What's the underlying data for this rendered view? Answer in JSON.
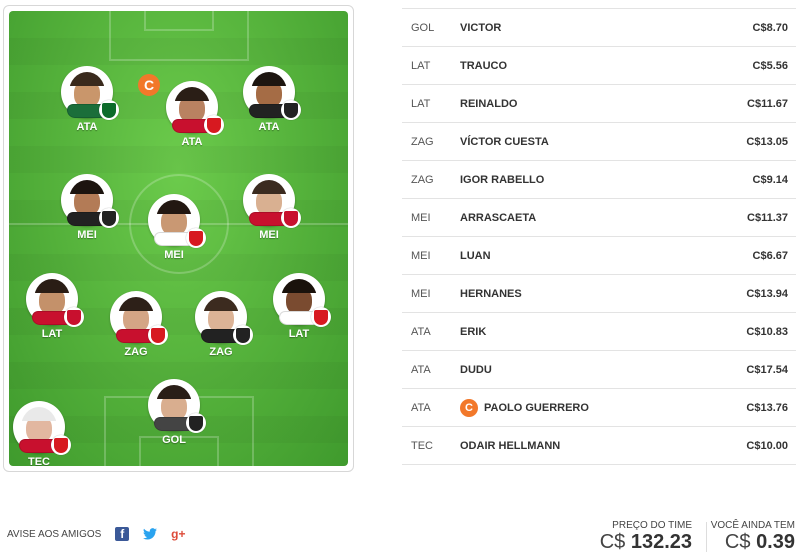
{
  "field": {
    "players": [
      {
        "pos": "ATA",
        "shirt": "#1b6e3a",
        "skin": "#c9966b",
        "hair": "#3a2a1d",
        "club_color": "#0c6b2a"
      },
      {
        "pos": "ATA",
        "shirt": "#c8102e",
        "skin": "#b98261",
        "hair": "#2a1e16",
        "club_color": "#d71920",
        "captain": true
      },
      {
        "pos": "ATA",
        "shirt": "#222222",
        "skin": "#a56c45",
        "hair": "#1d1510",
        "club_color": "#222222"
      },
      {
        "pos": "MEI",
        "shirt": "#222222",
        "skin": "#b37b56",
        "hair": "#1c140f",
        "club_color": "#222222"
      },
      {
        "pos": "MEI",
        "shirt": "#ffffff",
        "skin": "#c99873",
        "hair": "#221711",
        "club_color": "#d71920"
      },
      {
        "pos": "MEI",
        "shirt": "#c8102e",
        "skin": "#d9b091",
        "hair": "#3b2b20",
        "club_color": "#c8102e"
      },
      {
        "pos": "LAT",
        "shirt": "#c8102e",
        "skin": "#c4916a",
        "hair": "#2a1d15",
        "club_color": "#c8102e"
      },
      {
        "pos": "ZAG",
        "shirt": "#c8102e",
        "skin": "#d4a585",
        "hair": "#2d2018",
        "club_color": "#d71920"
      },
      {
        "pos": "ZAG",
        "shirt": "#222222",
        "skin": "#dcb396",
        "hair": "#3c2b1f",
        "club_color": "#222222"
      },
      {
        "pos": "LAT",
        "shirt": "#ffffff",
        "skin": "#7a4b30",
        "hair": "#1a120c",
        "club_color": "#d71920"
      },
      {
        "pos": "GOL",
        "shirt": "#444444",
        "skin": "#d9ae8f",
        "hair": "#2a1e17",
        "club_color": "#222222"
      },
      {
        "pos": "TEC",
        "shirt": "#c8102e",
        "skin": "#e2b7a0",
        "hair": "#e9e9e9",
        "club_color": "#d71920"
      }
    ],
    "captain_mark": "C"
  },
  "lineup": [
    {
      "pos": "GOL",
      "name": "VICTOR",
      "price": "C$8.70"
    },
    {
      "pos": "LAT",
      "name": "TRAUCO",
      "price": "C$5.56"
    },
    {
      "pos": "LAT",
      "name": "REINALDO",
      "price": "C$11.67"
    },
    {
      "pos": "ZAG",
      "name": "VÍCTOR CUESTA",
      "price": "C$13.05"
    },
    {
      "pos": "ZAG",
      "name": "IGOR RABELLO",
      "price": "C$9.14"
    },
    {
      "pos": "MEI",
      "name": "ARRASCAETA",
      "price": "C$11.37"
    },
    {
      "pos": "MEI",
      "name": "LUAN",
      "price": "C$6.67"
    },
    {
      "pos": "MEI",
      "name": "HERNANES",
      "price": "C$13.94"
    },
    {
      "pos": "ATA",
      "name": "ERIK",
      "price": "C$10.83"
    },
    {
      "pos": "ATA",
      "name": "DUDU",
      "price": "C$17.54"
    },
    {
      "pos": "ATA",
      "name": "PAOLO GUERRERO",
      "price": "C$13.76",
      "captain": true
    },
    {
      "pos": "TEC",
      "name": "ODAIR HELLMANN",
      "price": "C$10.00"
    }
  ],
  "footer": {
    "share_label": "AVISE AOS AMIGOS",
    "share_icons": [
      "facebook-icon",
      "twitter-icon",
      "google-plus-icon"
    ],
    "team_price_label": "PREÇO DO TIME",
    "team_price_currency": "C$",
    "team_price_value": "132.23",
    "remaining_label": "VOCÊ AINDA TEM",
    "remaining_currency": "C$",
    "remaining_value": "0.39"
  },
  "colors": {
    "captain": "#f2782a",
    "field": "#53b03a"
  }
}
